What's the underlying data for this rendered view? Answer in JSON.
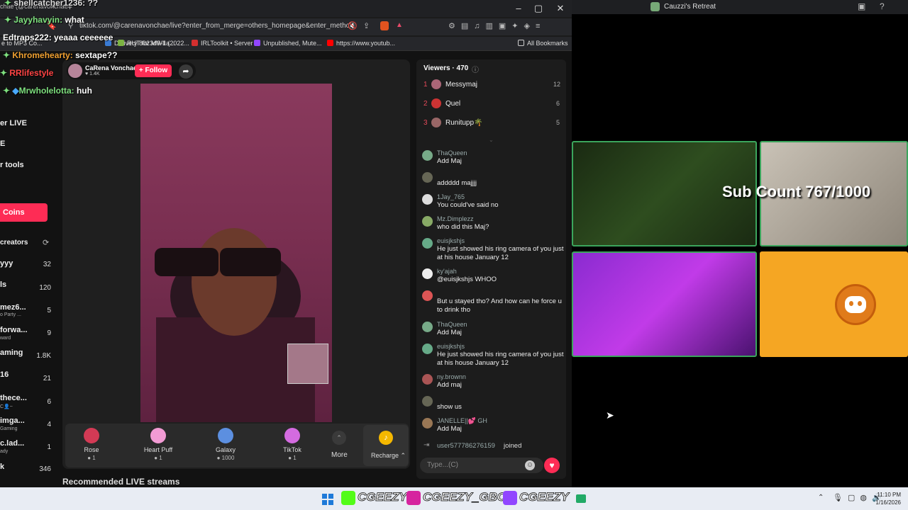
{
  "browser": {
    "tab_title": "chae (@carenavonchae",
    "url": "tiktok.com/@carenavonchae/live?enter_from_merge=others_homepage&enter_metho...",
    "bookmarks": [
      "e to MP3 Co...",
      "Delivery 8023d9-1a...",
      "RUT for MWII (2022...",
      "IRLToolkit • Server",
      "Unpublished, Mute...",
      "https://www.youtub...",
      "All Bookmarks"
    ]
  },
  "sidenav": {
    "items": [
      "er LIVE",
      "E",
      "r tools"
    ],
    "coins_label": "Coins",
    "creators_label": "creators",
    "creators": [
      {
        "name": "yyy",
        "sub": "",
        "value": "32"
      },
      {
        "name": "ls",
        "sub": "",
        "value": "120"
      },
      {
        "name": "mez6...",
        "sub": "o Party ...",
        "value": "5"
      },
      {
        "name": "forwa...",
        "sub": "ward",
        "value": "9"
      },
      {
        "name": "aming",
        "sub": "",
        "value": "1.8K"
      },
      {
        "name": "16",
        "sub": "",
        "value": "21"
      },
      {
        "name": "thece...",
        "sub": "C👤~",
        "value": "6"
      },
      {
        "name": "imga...",
        "sub": "Gaming",
        "value": "4"
      },
      {
        "name": "c.lad...",
        "sub": "ady",
        "value": "1"
      },
      {
        "name": "k",
        "sub": "",
        "value": "346"
      }
    ]
  },
  "host": {
    "name": "CaRena Vonchae",
    "likes": "1.4K",
    "follow_label": "+ Follow"
  },
  "gifts": [
    {
      "name": "Rose",
      "price": "1",
      "color": "#d33a55"
    },
    {
      "name": "Heart Puff",
      "price": "1",
      "color": "#f29bd4"
    },
    {
      "name": "Galaxy",
      "price": "1000",
      "color": "#5c8fe0"
    },
    {
      "name": "TikTok",
      "price": "1",
      "color": "#d46be0"
    }
  ],
  "gift_more_label": "More",
  "recharge_label": "Recharge",
  "recommended_label": "Recommended LIVE streams",
  "viewers": {
    "title": "Viewers · 470",
    "top": [
      {
        "rank": "1",
        "name": "Messymaj",
        "score": "12"
      },
      {
        "rank": "2",
        "name": "Quel",
        "score": "6"
      },
      {
        "rank": "3",
        "name": "Runitupp🌴",
        "score": "5"
      }
    ]
  },
  "chat": [
    {
      "user": "ThaQueen",
      "text": "Add Maj"
    },
    {
      "user": "",
      "text": "addddd majjjj"
    },
    {
      "user": "1Jay_765",
      "text": "You could've said no"
    },
    {
      "user": "Mz.Dimplezz",
      "text": "who did this Maj?"
    },
    {
      "user": "euisjkshjs",
      "text": "He just showed his ring camera of you just at his house January 12"
    },
    {
      "user": "ky'ajah",
      "text": "@euisjkshjs WHOO"
    },
    {
      "user": "",
      "text": "But u stayed tho? And how can he force u to drink tho"
    },
    {
      "user": "ThaQueen",
      "text": "Add Maj"
    },
    {
      "user": "euisjkshjs",
      "text": "He just showed his ring camera of you just at his house January 12"
    },
    {
      "user": "ny.brownn",
      "text": "Add maj"
    },
    {
      "user": "",
      "text": "show us"
    },
    {
      "user": "JANELLE||💕 GH",
      "text": "Add Maj"
    }
  ],
  "join_notice": {
    "user": "user577786276159",
    "text": "joined"
  },
  "chat_input_placeholder": "Type...(C)",
  "stream_overlay": [
    {
      "user": "shellcatcher1236:",
      "text": "??",
      "color": "#ffffff"
    },
    {
      "user": "Jayyhavyin:",
      "text": "what",
      "color": "#7ee07e"
    },
    {
      "user": "Edtraps222:",
      "text": "yeaaa ceeeeee",
      "color": "#ffffff"
    },
    {
      "user": "Khromehearty:",
      "text": "sextape??",
      "color": "#f0a030"
    },
    {
      "user": "RRlifestyle",
      "text": "",
      "color": "#ff4444"
    },
    {
      "user": "Mrwholelotta:",
      "text": "huh",
      "color": "#7ee07e"
    }
  ],
  "discord": {
    "window_title": "Cauzzi's Retreat",
    "sub_count": "Sub Count 767/1000"
  },
  "taskbar": {
    "socials": [
      "CGEEZY",
      "CGEEZY_GBC",
      "CGEEZY"
    ],
    "time": "11:10 PM",
    "date": "1/16/2026"
  }
}
